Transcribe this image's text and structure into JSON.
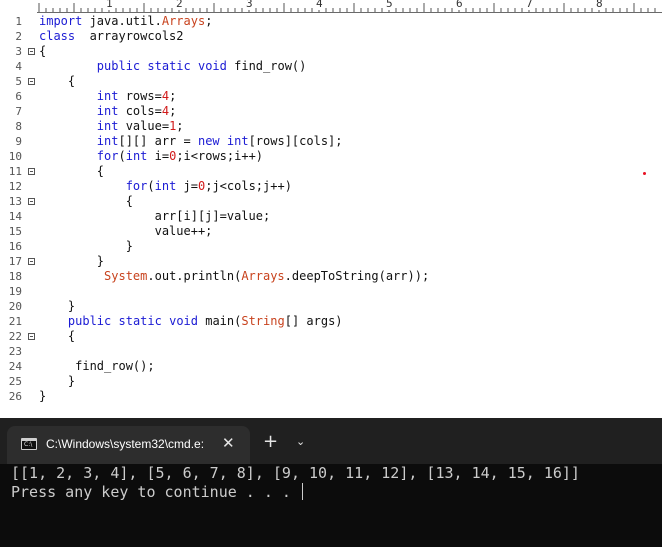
{
  "editor": {
    "ruler_numbers": [
      "1",
      "2",
      "3",
      "4",
      "5",
      "6",
      "7",
      "8"
    ],
    "lines": [
      {
        "n": "1",
        "fold": false,
        "parts": [
          {
            "t": "import",
            "c": "kw"
          },
          {
            "t": " java.util.",
            "c": ""
          },
          {
            "t": "Arrays",
            "c": "cls"
          },
          {
            "t": ";",
            "c": ""
          }
        ]
      },
      {
        "n": "2",
        "fold": false,
        "parts": [
          {
            "t": "class",
            "c": "kw"
          },
          {
            "t": "  arrayrowcols2",
            "c": ""
          }
        ]
      },
      {
        "n": "3",
        "fold": true,
        "parts": [
          {
            "t": "{",
            "c": ""
          }
        ]
      },
      {
        "n": "4",
        "fold": false,
        "parts": [
          {
            "t": "        ",
            "c": ""
          },
          {
            "t": "public",
            "c": "kw"
          },
          {
            "t": " ",
            "c": ""
          },
          {
            "t": "static",
            "c": "kw"
          },
          {
            "t": " ",
            "c": ""
          },
          {
            "t": "void",
            "c": "kw"
          },
          {
            "t": " find_row()",
            "c": ""
          }
        ]
      },
      {
        "n": "5",
        "fold": true,
        "parts": [
          {
            "t": "    {",
            "c": ""
          }
        ]
      },
      {
        "n": "6",
        "fold": false,
        "parts": [
          {
            "t": "        ",
            "c": ""
          },
          {
            "t": "int",
            "c": "kw"
          },
          {
            "t": " rows=",
            "c": ""
          },
          {
            "t": "4",
            "c": "num"
          },
          {
            "t": ";",
            "c": ""
          }
        ]
      },
      {
        "n": "7",
        "fold": false,
        "parts": [
          {
            "t": "        ",
            "c": ""
          },
          {
            "t": "int",
            "c": "kw"
          },
          {
            "t": " cols=",
            "c": ""
          },
          {
            "t": "4",
            "c": "num"
          },
          {
            "t": ";",
            "c": ""
          }
        ]
      },
      {
        "n": "8",
        "fold": false,
        "parts": [
          {
            "t": "        ",
            "c": ""
          },
          {
            "t": "int",
            "c": "kw"
          },
          {
            "t": " value=",
            "c": ""
          },
          {
            "t": "1",
            "c": "num"
          },
          {
            "t": ";",
            "c": ""
          }
        ]
      },
      {
        "n": "9",
        "fold": false,
        "parts": [
          {
            "t": "        ",
            "c": ""
          },
          {
            "t": "int",
            "c": "kw"
          },
          {
            "t": "[][] arr = ",
            "c": ""
          },
          {
            "t": "new",
            "c": "kw"
          },
          {
            "t": " ",
            "c": ""
          },
          {
            "t": "int",
            "c": "kw"
          },
          {
            "t": "[rows][cols];",
            "c": ""
          }
        ]
      },
      {
        "n": "10",
        "fold": false,
        "parts": [
          {
            "t": "        ",
            "c": ""
          },
          {
            "t": "for",
            "c": "kw"
          },
          {
            "t": "(",
            "c": ""
          },
          {
            "t": "int",
            "c": "kw"
          },
          {
            "t": " i=",
            "c": ""
          },
          {
            "t": "0",
            "c": "num"
          },
          {
            "t": ";i<rows;i++)",
            "c": ""
          }
        ]
      },
      {
        "n": "11",
        "fold": true,
        "parts": [
          {
            "t": "        {",
            "c": ""
          }
        ]
      },
      {
        "n": "12",
        "fold": false,
        "parts": [
          {
            "t": "            ",
            "c": ""
          },
          {
            "t": "for",
            "c": "kw"
          },
          {
            "t": "(",
            "c": ""
          },
          {
            "t": "int",
            "c": "kw"
          },
          {
            "t": " j=",
            "c": ""
          },
          {
            "t": "0",
            "c": "num"
          },
          {
            "t": ";j<cols;j++)",
            "c": ""
          }
        ]
      },
      {
        "n": "13",
        "fold": true,
        "parts": [
          {
            "t": "            {",
            "c": ""
          }
        ]
      },
      {
        "n": "14",
        "fold": false,
        "parts": [
          {
            "t": "                arr[i][j]=value;",
            "c": ""
          }
        ]
      },
      {
        "n": "15",
        "fold": false,
        "parts": [
          {
            "t": "                value++;",
            "c": ""
          }
        ]
      },
      {
        "n": "16",
        "fold": false,
        "parts": [
          {
            "t": "            }",
            "c": ""
          }
        ]
      },
      {
        "n": "17",
        "fold": true,
        "parts": [
          {
            "t": "        }",
            "c": ""
          }
        ]
      },
      {
        "n": "18",
        "fold": false,
        "parts": [
          {
            "t": "         ",
            "c": ""
          },
          {
            "t": "System",
            "c": "cls"
          },
          {
            "t": ".out.println(",
            "c": ""
          },
          {
            "t": "Arrays",
            "c": "cls"
          },
          {
            "t": ".deepToString(arr));",
            "c": ""
          }
        ]
      },
      {
        "n": "19",
        "fold": false,
        "parts": []
      },
      {
        "n": "20",
        "fold": false,
        "parts": [
          {
            "t": "    }",
            "c": ""
          }
        ]
      },
      {
        "n": "21",
        "fold": false,
        "parts": [
          {
            "t": "    ",
            "c": ""
          },
          {
            "t": "public",
            "c": "kw"
          },
          {
            "t": " ",
            "c": ""
          },
          {
            "t": "static",
            "c": "kw"
          },
          {
            "t": " ",
            "c": ""
          },
          {
            "t": "void",
            "c": "kw"
          },
          {
            "t": " main(",
            "c": ""
          },
          {
            "t": "String",
            "c": "cls"
          },
          {
            "t": "[] args)",
            "c": ""
          }
        ]
      },
      {
        "n": "22",
        "fold": true,
        "parts": [
          {
            "t": "    {",
            "c": ""
          }
        ]
      },
      {
        "n": "23",
        "fold": false,
        "parts": []
      },
      {
        "n": "24",
        "fold": false,
        "parts": [
          {
            "t": "     find_row();",
            "c": ""
          }
        ]
      },
      {
        "n": "25",
        "fold": false,
        "parts": [
          {
            "t": "    }",
            "c": ""
          }
        ]
      },
      {
        "n": "26",
        "fold": false,
        "parts": [
          {
            "t": "}",
            "c": ""
          }
        ]
      }
    ]
  },
  "terminal": {
    "tab_title": "C:\\Windows\\system32\\cmd.e:",
    "tab_icon_text": "C:\\",
    "close_glyph": "✕",
    "new_tab_glyph": "+",
    "dropdown_glyph": "⌄",
    "output": [
      "[[1, 2, 3, 4], [5, 6, 7, 8], [9, 10, 11, 12], [13, 14, 15, 16]]",
      "Press any key to continue . . . "
    ]
  },
  "colors": {
    "keyword": "#1b1bd4",
    "class_name": "#c8421d",
    "number": "#d11a1a",
    "terminal_bg": "#0c0c0c",
    "tabbar_bg": "#202020"
  }
}
